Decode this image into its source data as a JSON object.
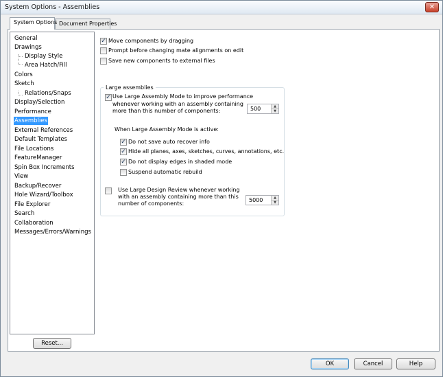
{
  "window": {
    "title": "System Options - Assemblies",
    "close_glyph": "✕"
  },
  "tabs": [
    {
      "label": "System Options",
      "active": true
    },
    {
      "label": "Document Properties",
      "active": false
    }
  ],
  "tree": {
    "items": [
      {
        "label": "General"
      },
      {
        "label": "Drawings"
      },
      {
        "label": "Display Style"
      },
      {
        "label": "Area Hatch/Fill"
      },
      {
        "label": "Colors"
      },
      {
        "label": "Sketch"
      },
      {
        "label": "Relations/Snaps"
      },
      {
        "label": "Display/Selection"
      },
      {
        "label": "Performance"
      },
      {
        "label": "Assemblies",
        "selected": true
      },
      {
        "label": "External References"
      },
      {
        "label": "Default Templates"
      },
      {
        "label": "File Locations"
      },
      {
        "label": "FeatureManager"
      },
      {
        "label": "Spin Box Increments"
      },
      {
        "label": "View"
      },
      {
        "label": "Backup/Recover"
      },
      {
        "label": "Hole Wizard/Toolbox"
      },
      {
        "label": "File Explorer"
      },
      {
        "label": "Search"
      },
      {
        "label": "Collaboration"
      },
      {
        "label": "Messages/Errors/Warnings"
      }
    ]
  },
  "options": {
    "move_by_dragging": {
      "label": "Move components by dragging",
      "checked": true
    },
    "prompt_mate_alignments": {
      "label": "Prompt before changing mate alignments on edit",
      "checked": false
    },
    "save_external": {
      "label": "Save new components to external files",
      "checked": false
    }
  },
  "large_assemblies": {
    "title": "Large assemblies",
    "use_lam": {
      "label_line1": "Use Large Assembly Mode to improve performance",
      "label_line2": "whenever working with an assembly containing",
      "label_line3": "more than this number of components:",
      "checked": true
    },
    "lam_threshold": "500",
    "when_active_label": "When Large Assembly Mode is active:",
    "no_auto_recover": {
      "label": "Do not save auto recover info",
      "checked": true
    },
    "hide_planes": {
      "label": "Hide all planes, axes, sketches, curves, annotations, etc.",
      "checked": true
    },
    "no_edges": {
      "label": "Do not display edges in shaded mode",
      "checked": true
    },
    "suspend_rebuild": {
      "label": "Suspend automatic rebuild",
      "checked": false
    },
    "use_ldr": {
      "label_line1": "Use Large Design Review whenever working",
      "label_line2": "with an assembly containing more than this",
      "label_line3": "number of components:",
      "checked": false
    },
    "ldr_threshold": "5000"
  },
  "buttons": {
    "reset": "Reset...",
    "ok": "OK",
    "cancel": "Cancel",
    "help": "Help"
  },
  "glyphs": {
    "check": "✓",
    "spin_up": "▲",
    "spin_down": "▼"
  },
  "colors": {
    "selection": "#3399ff",
    "close_button": "#c7412a"
  }
}
